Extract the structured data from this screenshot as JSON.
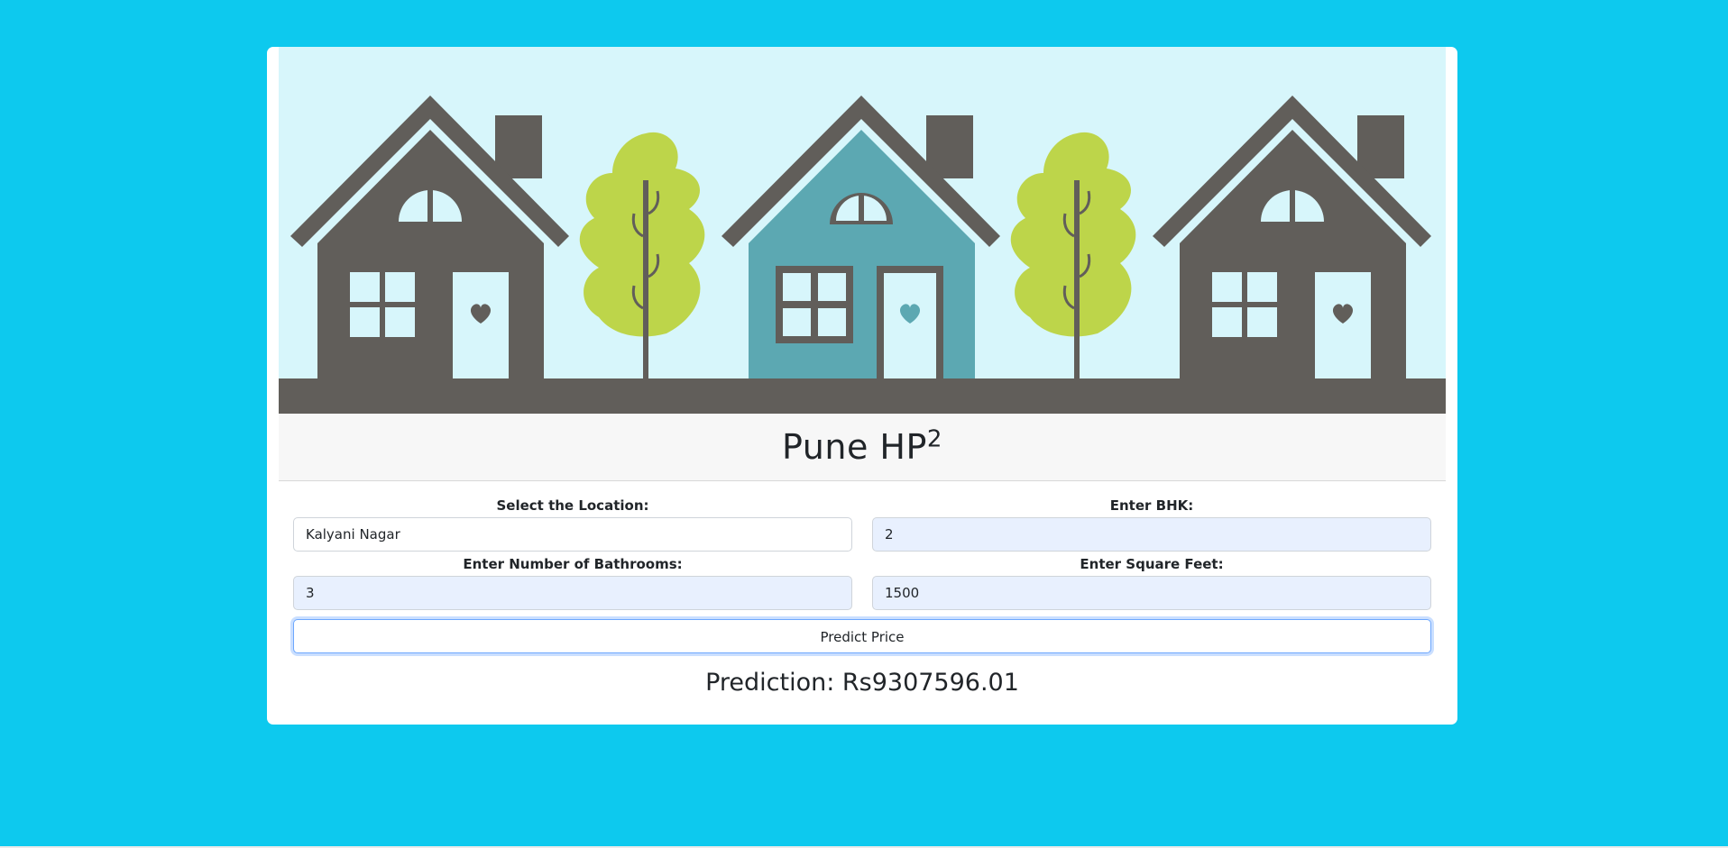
{
  "colors": {
    "page_background": "#0dc9ee",
    "banner_sky": "#d7f6fb",
    "house_gray": "#615e5a",
    "house_teal": "#5ca8b2",
    "tree_green": "#bdd54a"
  },
  "banner": {
    "icons": [
      "house-icon",
      "tree-icon",
      "house-icon",
      "tree-icon",
      "house-icon"
    ]
  },
  "header": {
    "title": "Pune HP",
    "superscript": "2"
  },
  "form": {
    "location": {
      "label": "Select the Location:",
      "value": "Kalyani Nagar"
    },
    "bhk": {
      "label": "Enter BHK:",
      "value": "2"
    },
    "bathrooms": {
      "label": "Enter Number of Bathrooms:",
      "value": "3"
    },
    "sqft": {
      "label": "Enter Square Feet:",
      "value": "1500"
    },
    "predict_label": "Predict Price"
  },
  "result": {
    "text": "Prediction: Rs9307596.01"
  }
}
